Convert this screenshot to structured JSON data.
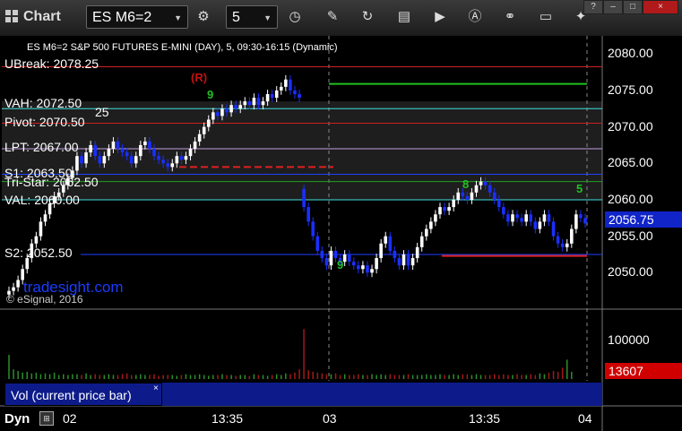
{
  "toolbar": {
    "title": "Chart",
    "symbol": "ES M6=2",
    "interval": "5",
    "window_controls": [
      "?",
      "–",
      "□",
      "×"
    ]
  },
  "header": "ES M6=2 S&P 500 FUTURES E-MINI (DAY), 5, 09:30-16:15 (Dynamic)",
  "watermark": "tradesight.com",
  "copyright": "© eSignal, 2016",
  "current_price_badge": "2056.75",
  "volume_badge": "13607",
  "volume_tick": "100000",
  "volume_legend": "Vol (current price bar)",
  "volume_close": "×",
  "footer_label": "Dyn",
  "colors": {
    "up_bar": "#ffffff",
    "down_bar": "#1a2fff",
    "volume_up": "#2a8f2a",
    "volume_down": "#a01a1a",
    "panel_highlight": "#1e1e1e",
    "price_badge": "#1024c8",
    "volume_badge": "#d00000"
  },
  "level_labels": [
    {
      "text": "UBreak: 2078.25",
      "price": 2078.25
    },
    {
      "text": "VAH: 2072.50",
      "price": 2072.5
    },
    {
      "text": "Pivot: 2070.50",
      "price": 2070.5
    },
    {
      "text": "LPT: 2067.00",
      "price": 2067.0
    },
    {
      "text": "S1: 2063.50",
      "price": 2063.5
    },
    {
      "text": "Tri-Star: 2062.50",
      "price": 2062.5
    },
    {
      "text": "VAL: 2060.00",
      "price": 2060.0
    },
    {
      "text": "S2: 2052.50",
      "price": 2052.5
    }
  ],
  "markers": [
    {
      "text": "(R)",
      "color": "#c01010"
    },
    {
      "text": "9",
      "color": "#22c022"
    },
    {
      "text": "8",
      "color": "#22c022"
    },
    {
      "text": "9",
      "color": "#22c022"
    },
    {
      "text": "25",
      "color": "#ffffff"
    },
    {
      "text": "5",
      "color": "#22c022"
    }
  ],
  "chart_data": {
    "type": "candlestick",
    "title": "ES M6=2 S&P 500 FUTURES E-MINI (DAY), 5, 09:30-16:15 (Dynamic)",
    "ylim": [
      2045,
      2082
    ],
    "y_ticks": [
      2050,
      2055,
      2060,
      2065,
      2070,
      2075,
      2080
    ],
    "x_ticks": [
      "02",
      "13:35",
      "03",
      "13:35",
      "04"
    ],
    "grid": true,
    "levels": [
      {
        "name": "UBreak",
        "price": 2078.25,
        "color": "#cc2020",
        "style": "solid"
      },
      {
        "name": "green line",
        "price": 2075.9,
        "color": "#20c020",
        "style": "solid"
      },
      {
        "name": "VAH",
        "price": 2072.5,
        "color": "#40e0e0",
        "style": "solid"
      },
      {
        "name": "Pivot",
        "price": 2070.5,
        "color": "#cc2020",
        "style": "solid"
      },
      {
        "name": "LPT",
        "price": 2067.0,
        "color": "#c0a0e0",
        "style": "solid"
      },
      {
        "name": "S1",
        "price": 2063.5,
        "color": "#2040ff",
        "style": "solid"
      },
      {
        "name": "red dashed",
        "price": 2064.5,
        "color": "#e02020",
        "style": "dashed"
      },
      {
        "name": "Tri-Star",
        "price": 2062.5,
        "color": "#20a020",
        "style": "solid"
      },
      {
        "name": "VAL",
        "price": 2060.0,
        "color": "#40e0e0",
        "style": "solid"
      },
      {
        "name": "S2",
        "price": 2052.5,
        "color": "#2040ff",
        "style": "solid"
      },
      {
        "name": "red low",
        "price": 2052.3,
        "color": "#e02020",
        "style": "solid"
      }
    ],
    "closes": [
      2047.5,
      2048,
      2049,
      2050.5,
      2052,
      2054,
      2055,
      2057,
      2058,
      2059.5,
      2060.5,
      2061,
      2062,
      2063,
      2064,
      2066,
      2065,
      2066.5,
      2067.5,
      2066,
      2065,
      2066,
      2067,
      2068,
      2067,
      2066.5,
      2066,
      2065,
      2066,
      2067.5,
      2068,
      2067,
      2066,
      2065.5,
      2065,
      2064.5,
      2065,
      2066,
      2065.5,
      2066,
      2067,
      2068,
      2069,
      2070,
      2071,
      2072,
      2071.5,
      2072.5,
      2072,
      2073,
      2072.5,
      2073,
      2073.5,
      2073,
      2074,
      2073,
      2073.5,
      2074.5,
      2074,
      2075,
      2075.5,
      2076.5,
      2075,
      2074.5,
      2074,
      2059,
      2057,
      2055,
      2053,
      2052,
      2051,
      2053,
      2052,
      2051.5,
      2052.5,
      2051.5,
      2051,
      2050.5,
      2051,
      2050,
      2050.5,
      2052,
      2054,
      2055,
      2053,
      2052,
      2051,
      2052.5,
      2051,
      2052,
      2053.5,
      2055,
      2056,
      2057,
      2058,
      2059,
      2058.5,
      2059,
      2060,
      2061,
      2060.5,
      2060,
      2061,
      2062,
      2062.5,
      2062,
      2061,
      2060,
      2059,
      2058,
      2057,
      2058,
      2057.5,
      2057,
      2058,
      2057,
      2056,
      2057,
      2058,
      2057,
      2055,
      2054,
      2053.5,
      2054,
      2056,
      2058,
      2057.5,
      2056.75
    ],
    "volumes": [
      30,
      12,
      10,
      8,
      9,
      7,
      8,
      6,
      7,
      6,
      8,
      5,
      6,
      5,
      6,
      6,
      5,
      7,
      5,
      6,
      5,
      5,
      6,
      5,
      5,
      6,
      7,
      5,
      5,
      6,
      5,
      5,
      6,
      4,
      5,
      5,
      5,
      4,
      5,
      6,
      5,
      5,
      6,
      5,
      4,
      5,
      5,
      6,
      5,
      5,
      4,
      5,
      5,
      4,
      6,
      5,
      5,
      4,
      5,
      6,
      5,
      7,
      6,
      8,
      12,
      62,
      11,
      9,
      8,
      7,
      6,
      6,
      7,
      5,
      6,
      5,
      5,
      6,
      5,
      5,
      6,
      5,
      6,
      5,
      6,
      5,
      5,
      5,
      6,
      5,
      5,
      5,
      6,
      5,
      5,
      6,
      5,
      5,
      6,
      5,
      6,
      6,
      5,
      6,
      5,
      5,
      5,
      6,
      5,
      6,
      5,
      5,
      6,
      5,
      5,
      6,
      5,
      7,
      6,
      8,
      10,
      9,
      14,
      24,
      9,
      13607
    ]
  },
  "price_ticks": [
    "2080.00",
    "2075.00",
    "2070.00",
    "2065.00",
    "2060.00",
    "2055.00",
    "2050.00"
  ],
  "time_ticks": [
    "02",
    "13:35",
    "03",
    "13:35",
    "04"
  ]
}
